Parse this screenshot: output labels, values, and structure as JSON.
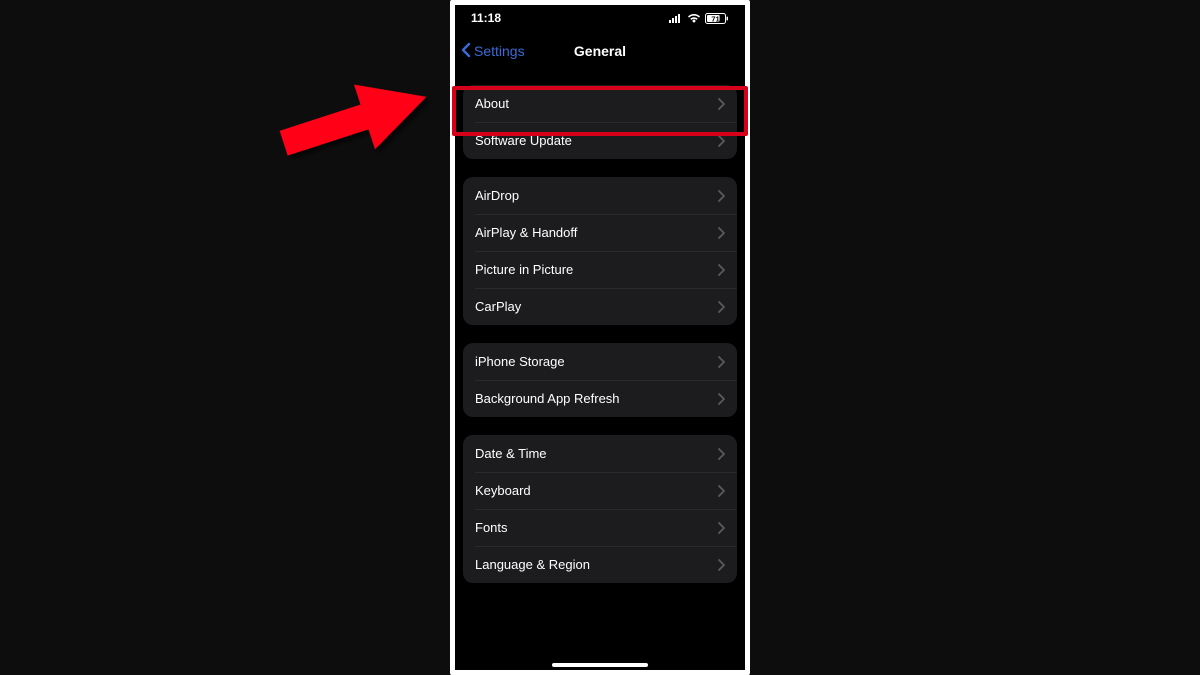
{
  "status": {
    "time": "11:18",
    "battery": "71"
  },
  "nav": {
    "back": "Settings",
    "title": "General"
  },
  "groups": [
    {
      "items": [
        {
          "id": "about",
          "label": "About"
        },
        {
          "id": "software-update",
          "label": "Software Update"
        }
      ]
    },
    {
      "items": [
        {
          "id": "airdrop",
          "label": "AirDrop"
        },
        {
          "id": "airplay-handoff",
          "label": "AirPlay & Handoff"
        },
        {
          "id": "picture-in-picture",
          "label": "Picture in Picture"
        },
        {
          "id": "carplay",
          "label": "CarPlay"
        }
      ]
    },
    {
      "items": [
        {
          "id": "iphone-storage",
          "label": "iPhone Storage"
        },
        {
          "id": "background-app-refresh",
          "label": "Background App Refresh"
        }
      ]
    },
    {
      "items": [
        {
          "id": "date-time",
          "label": "Date & Time"
        },
        {
          "id": "keyboard",
          "label": "Keyboard"
        },
        {
          "id": "fonts",
          "label": "Fonts"
        },
        {
          "id": "language-region",
          "label": "Language & Region"
        }
      ]
    }
  ],
  "annotation": {
    "highlighted_item": "about",
    "arrow_color": "#ff0015"
  }
}
